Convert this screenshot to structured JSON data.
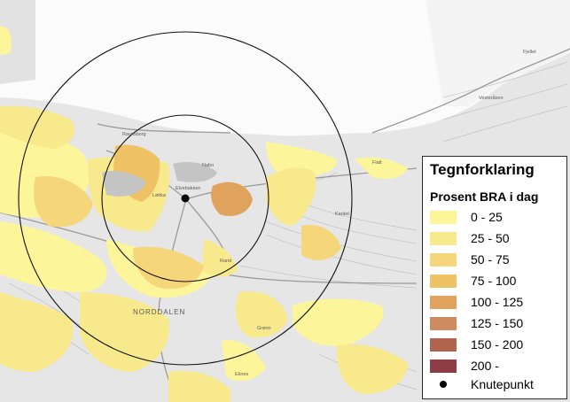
{
  "legend": {
    "title": "Tegnforklaring",
    "subtitle": "Prosent BRA i dag",
    "classes": [
      {
        "label": "0 - 25",
        "color": "#fdf59a"
      },
      {
        "label": "25 - 50",
        "color": "#f8e98d"
      },
      {
        "label": "50 - 75",
        "color": "#f5d67a"
      },
      {
        "label": "75 - 100",
        "color": "#f0c266"
      },
      {
        "label": "100 - 125",
        "color": "#e0a35d"
      },
      {
        "label": "125 - 150",
        "color": "#cd8b5f"
      },
      {
        "label": "150 - 200",
        "color": "#b0644e"
      },
      {
        "label": "200 -",
        "color": "#8f3d45"
      }
    ],
    "point_label": "Knutepunkt"
  },
  "map": {
    "labels": {
      "district": "NORDDALEN",
      "p1": "Flatt",
      "p2": "Kantet",
      "p3": "Ravnsborg",
      "p4": "Løkka",
      "p5": "Elvebakken",
      "p6": "Nabo",
      "p7": "Rand",
      "p8": "Vesteråsen",
      "p9": "Fjellet",
      "p10": "Grønn",
      "p11": "Eknes"
    }
  }
}
